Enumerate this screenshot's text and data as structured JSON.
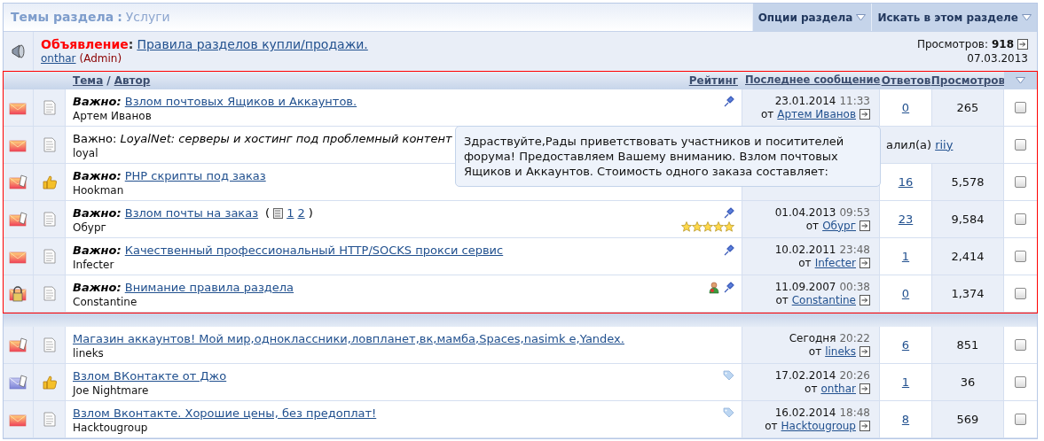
{
  "header": {
    "title": "Темы раздела",
    "separator": ":",
    "section": "Услуги",
    "buttons": [
      "Опции раздела",
      "Искать в этом разделе"
    ]
  },
  "announcement": {
    "label": "Объявление",
    "colon": ":",
    "link": "Правила разделов купли/продажи.",
    "author": "onthar",
    "role": "(Admin)",
    "views_label": "Просмотров:",
    "views": "918",
    "date": "07.03.2013"
  },
  "columns": {
    "topic": "Тема",
    "slash": "/",
    "author": "Автор",
    "rating": "Рейтинг",
    "last_post": "Последнее сообщение",
    "replies": "Ответов",
    "views": "Просмотров"
  },
  "sticky_rows": [
    {
      "kind": "thread",
      "status_icon": {
        "kind": "envelope"
      },
      "post_icon": {
        "kind": "page"
      },
      "prefix": "Важно:",
      "title": "Взлом почтовых Ящиков и Аккаунтов.",
      "author": "Артем Иванов",
      "icons": [
        {
          "kind": "pin"
        }
      ],
      "date": "23.01.2014",
      "time": "11:33",
      "from": "от",
      "user": "Артем Иванов",
      "replies": "0",
      "views": "265",
      "checked": false
    },
    {
      "kind": "moved",
      "status_icon": {
        "kind": "envelope"
      },
      "post_icon": {
        "kind": "page"
      },
      "prefix": "Важно:",
      "title": "LoyalNet: серверы и хостинг под проблемный контент",
      "author": "loyal",
      "note": "алил(а)",
      "user": "riiy",
      "checked": false
    },
    {
      "kind": "covered",
      "status_icon": {
        "kind": "envelope-pen"
      },
      "post_icon": {
        "kind": "thumb"
      },
      "prefix": "Важно:",
      "title": "PHP скрипты под заказ",
      "author": "Hookman",
      "replies": "16",
      "views": "5,578",
      "checked": false
    },
    {
      "kind": "thread",
      "status_icon": {
        "kind": "envelope-pen"
      },
      "post_icon": {
        "kind": "page"
      },
      "prefix": "Важно:",
      "title": "Взлом почты на заказ",
      "pages_open": "(",
      "pages": [
        "1",
        "2"
      ],
      "pages_close": ")",
      "author": "Обург",
      "icons": [
        {
          "kind": "pin"
        }
      ],
      "stars": 5,
      "date": "01.04.2013",
      "time": "09:53",
      "from": "от",
      "user": "Обург",
      "replies": "23",
      "views": "9,584",
      "checked": false
    },
    {
      "kind": "thread",
      "status_icon": {
        "kind": "envelope"
      },
      "post_icon": {
        "kind": "page"
      },
      "prefix": "Важно:",
      "title": "Качественный профессиональный HTTP/SOCKS прокси сервис",
      "author": "Infecter",
      "icons": [
        {
          "kind": "pin"
        }
      ],
      "date": "10.02.2011",
      "time": "23:48",
      "from": "от",
      "user": "Infecter",
      "replies": "1",
      "views": "2,414",
      "checked": false
    },
    {
      "kind": "thread",
      "status_icon": {
        "kind": "lock"
      },
      "post_icon": {
        "kind": "page"
      },
      "prefix": "Важно:",
      "title": "Внимание правила раздела",
      "author": "Constantine",
      "icons": [
        {
          "kind": "user"
        },
        {
          "kind": "pin"
        }
      ],
      "date": "11.09.2007",
      "time": "00:38",
      "from": "от",
      "user": "Constantine",
      "replies": "0",
      "views": "1,374",
      "checked": false
    }
  ],
  "tooltip": "Здраствуйте,Рады приветствовать участников и поситителей форума! Предоставляем Вашему вниманию. Взлом почтовых Ящиков и Аккаунтов. Стоимость одного заказа составляет:",
  "rows": [
    {
      "kind": "thread",
      "status_icon": {
        "kind": "envelope-pen"
      },
      "post_icon": {
        "kind": "page"
      },
      "title": "Магазин аккаунтов! Мой мир,одноклассники,ловпланет,вк,мамба,Spaces,nasimk e,Yandex.",
      "author": "lineks",
      "date": "Сегодня",
      "time": "20:22",
      "from": "от",
      "user": "lineks",
      "replies": "6",
      "views": "851",
      "checked": false
    },
    {
      "kind": "thread",
      "status_icon": {
        "kind": "envelope-blue-pen"
      },
      "post_icon": {
        "kind": "thumb"
      },
      "title": "Взлом ВКонтакте от Джо",
      "author": "Joe Nightmare",
      "icons": [
        {
          "kind": "tag"
        }
      ],
      "date": "17.02.2014",
      "time": "20:26",
      "from": "от",
      "user": "onthar",
      "replies": "1",
      "views": "36",
      "checked": false
    },
    {
      "kind": "thread",
      "status_icon": {
        "kind": "envelope"
      },
      "post_icon": {
        "kind": "page"
      },
      "title": "Взлом Вконтакте. Хорошие цены, без предоплат!",
      "author": "Hacktougroup",
      "icons": [
        {
          "kind": "tag"
        }
      ],
      "date": "16.02.2014",
      "time": "18:48",
      "from": "от",
      "user": "Hacktougroup",
      "replies": "8",
      "views": "569",
      "checked": false
    }
  ]
}
